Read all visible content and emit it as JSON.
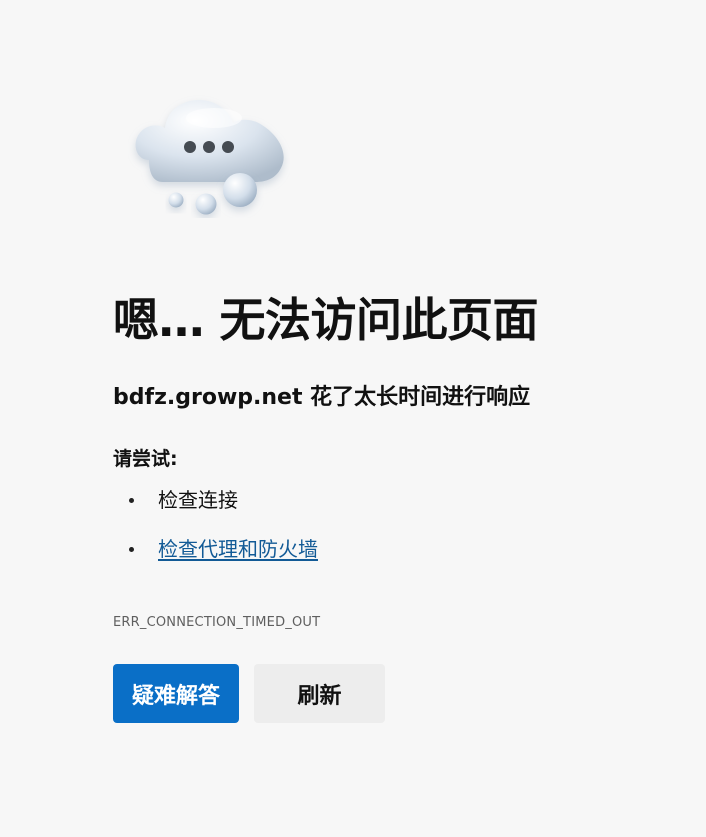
{
  "error_page": {
    "title": "嗯… 无法访问此页面",
    "subtitle": "bdfz.growp.net 花了太长时间进行响应",
    "try_label": "请尝试:",
    "suggestions": [
      "检查连接",
      "检查代理和防火墙"
    ],
    "error_code": "ERR_CONNECTION_TIMED_OUT"
  },
  "buttons": {
    "troubleshoot": "疑难解答",
    "refresh": "刷新"
  },
  "icons": {
    "cloud": "cloud-ellipsis-icon"
  },
  "colors": {
    "primary": "#0a6fc7",
    "link": "#125a96",
    "background": "#f7f7f7"
  }
}
